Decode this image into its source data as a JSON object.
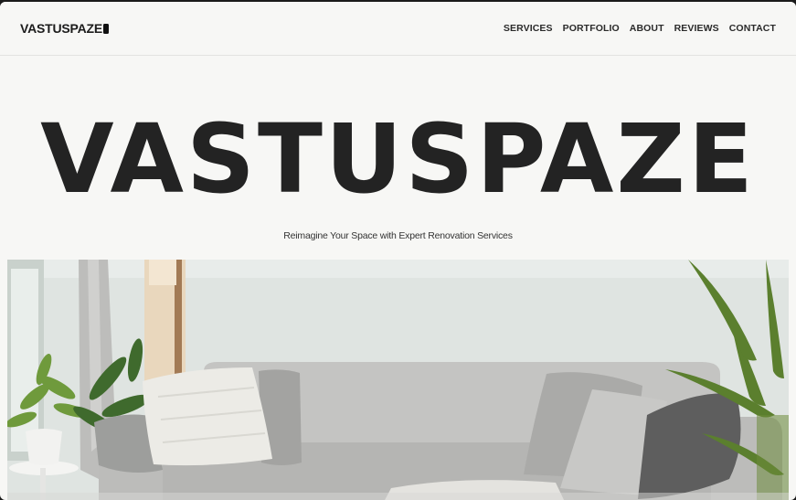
{
  "brand": {
    "name": "VASTUSPAZE"
  },
  "nav": {
    "items": [
      {
        "label": "SERVICES"
      },
      {
        "label": "PORTFOLIO"
      },
      {
        "label": "ABOUT"
      },
      {
        "label": "REVIEWS"
      },
      {
        "label": "CONTACT"
      }
    ]
  },
  "hero": {
    "title": "VASTUSPAZE",
    "subtitle": "Reimagine Your Space with Expert Renovation Services"
  },
  "colors": {
    "background": "#f7f7f5",
    "text": "#232323",
    "wall": "#dfe4e1",
    "sofa": "#b9b9b7"
  },
  "icons": {
    "logo_mark": "rounded-bar-mark"
  }
}
